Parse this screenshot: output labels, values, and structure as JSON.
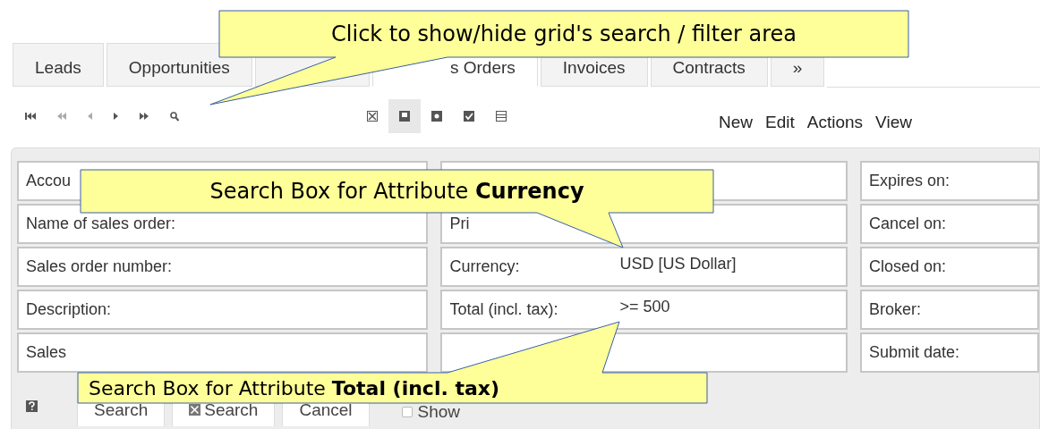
{
  "tabs": [
    {
      "label": "Leads",
      "selected": false
    },
    {
      "label": "Opportunities",
      "selected": false
    },
    {
      "selected": false
    },
    {
      "label": "s Orders",
      "selected": true
    },
    {
      "label": "Invoices",
      "selected": false
    },
    {
      "label": "Contracts",
      "selected": false
    },
    {
      "label": "»",
      "selected": false
    }
  ],
  "view_toggles": [
    {
      "selected": false
    },
    {
      "selected": true
    },
    {
      "selected": false
    },
    {
      "selected": false
    },
    {
      "selected": false
    }
  ],
  "menu": [
    "New",
    "Edit",
    "Actions",
    "View"
  ],
  "form_columns": [
    [
      {
        "label": "Accou"
      },
      {
        "label": "Name of sales order:"
      },
      {
        "label": "Sales order number:"
      },
      {
        "label": "Description:"
      },
      {
        "label": "Sales"
      }
    ],
    [
      {},
      {
        "label": "Pri"
      },
      {
        "label": "Currency:",
        "value": "USD [US Dollar]"
      },
      {
        "label": "Total (incl. tax):",
        "value": ">= 500"
      },
      {}
    ],
    [
      {
        "label": "Expires on:"
      },
      {
        "label": "Cancel on:"
      },
      {
        "label": "Closed on:"
      },
      {
        "label": "Broker:"
      },
      {
        "label": "Submit date:"
      }
    ]
  ],
  "bottom_buttons": [
    {
      "label": "Search",
      "kind": "plain"
    },
    {
      "label": "Search",
      "kind": "clear"
    },
    {
      "label": "Cancel",
      "kind": "plain"
    }
  ],
  "show_checkbox": {
    "label": "Show",
    "checked": false
  },
  "callouts": [
    "Click to show/hide grid's search / filter area",
    "Search Box for Attribute **Currency**",
    "Search Box for Attribute **Total (incl. tax)**"
  ]
}
